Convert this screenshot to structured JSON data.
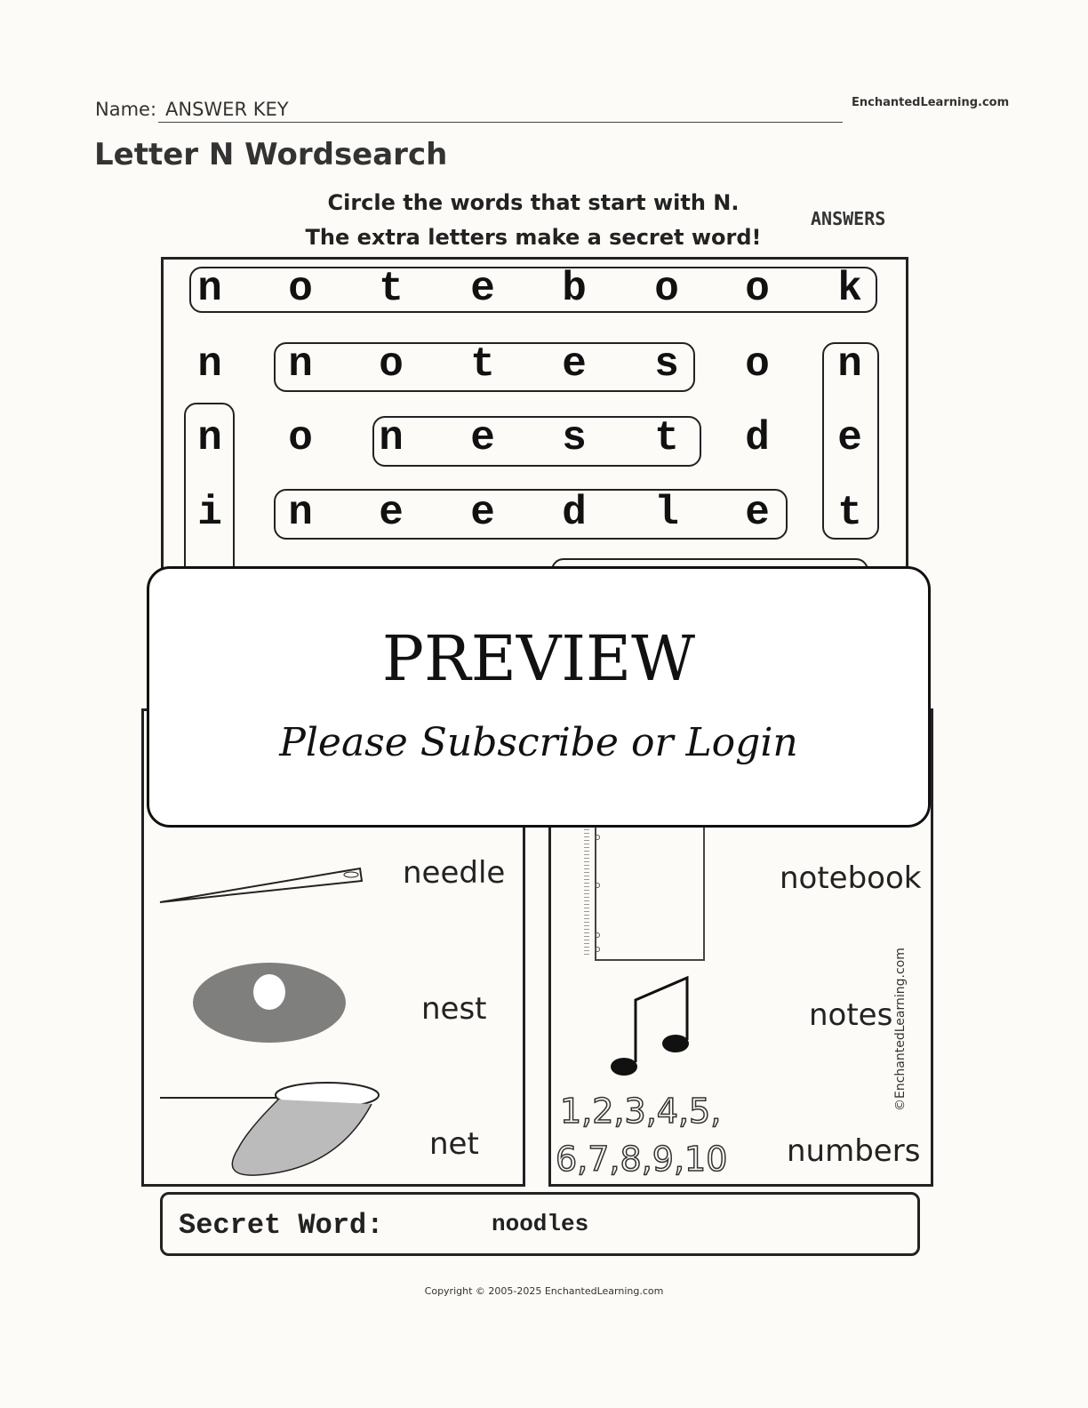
{
  "header": {
    "name_label": "Name:",
    "name_value": "ANSWER KEY",
    "site": "EnchantedLearning.com"
  },
  "title": "Letter N Wordsearch",
  "instructions": {
    "line1": "Circle the words that start with N.",
    "line2": "The extra letters make a secret word!",
    "answers_label": "ANSWERS"
  },
  "grid": {
    "rows": [
      [
        "n",
        "o",
        "t",
        "e",
        "b",
        "o",
        "o",
        "k"
      ],
      [
        "n",
        "n",
        "o",
        "t",
        "e",
        "s",
        "o",
        "n"
      ],
      [
        "n",
        "o",
        "n",
        "e",
        "s",
        "t",
        "d",
        "e"
      ],
      [
        "i",
        "n",
        "e",
        "e",
        "d",
        "l",
        "e",
        "t"
      ]
    ]
  },
  "words": {
    "left": [
      "needle",
      "nest",
      "net"
    ],
    "right": [
      "notebook",
      "notes",
      "numbers"
    ]
  },
  "numbers_art": {
    "line1": "1,2,3,4,5,",
    "line2": "6,7,8,9,10"
  },
  "watermark": "©EnchantedLearning.com",
  "overlay": {
    "title": "PREVIEW",
    "subtitle": "Please Subscribe or Login"
  },
  "secret": {
    "label": "Secret Word:",
    "value": "noodles"
  },
  "copyright": "Copyright © 2005-2025 EnchantedLearning.com"
}
